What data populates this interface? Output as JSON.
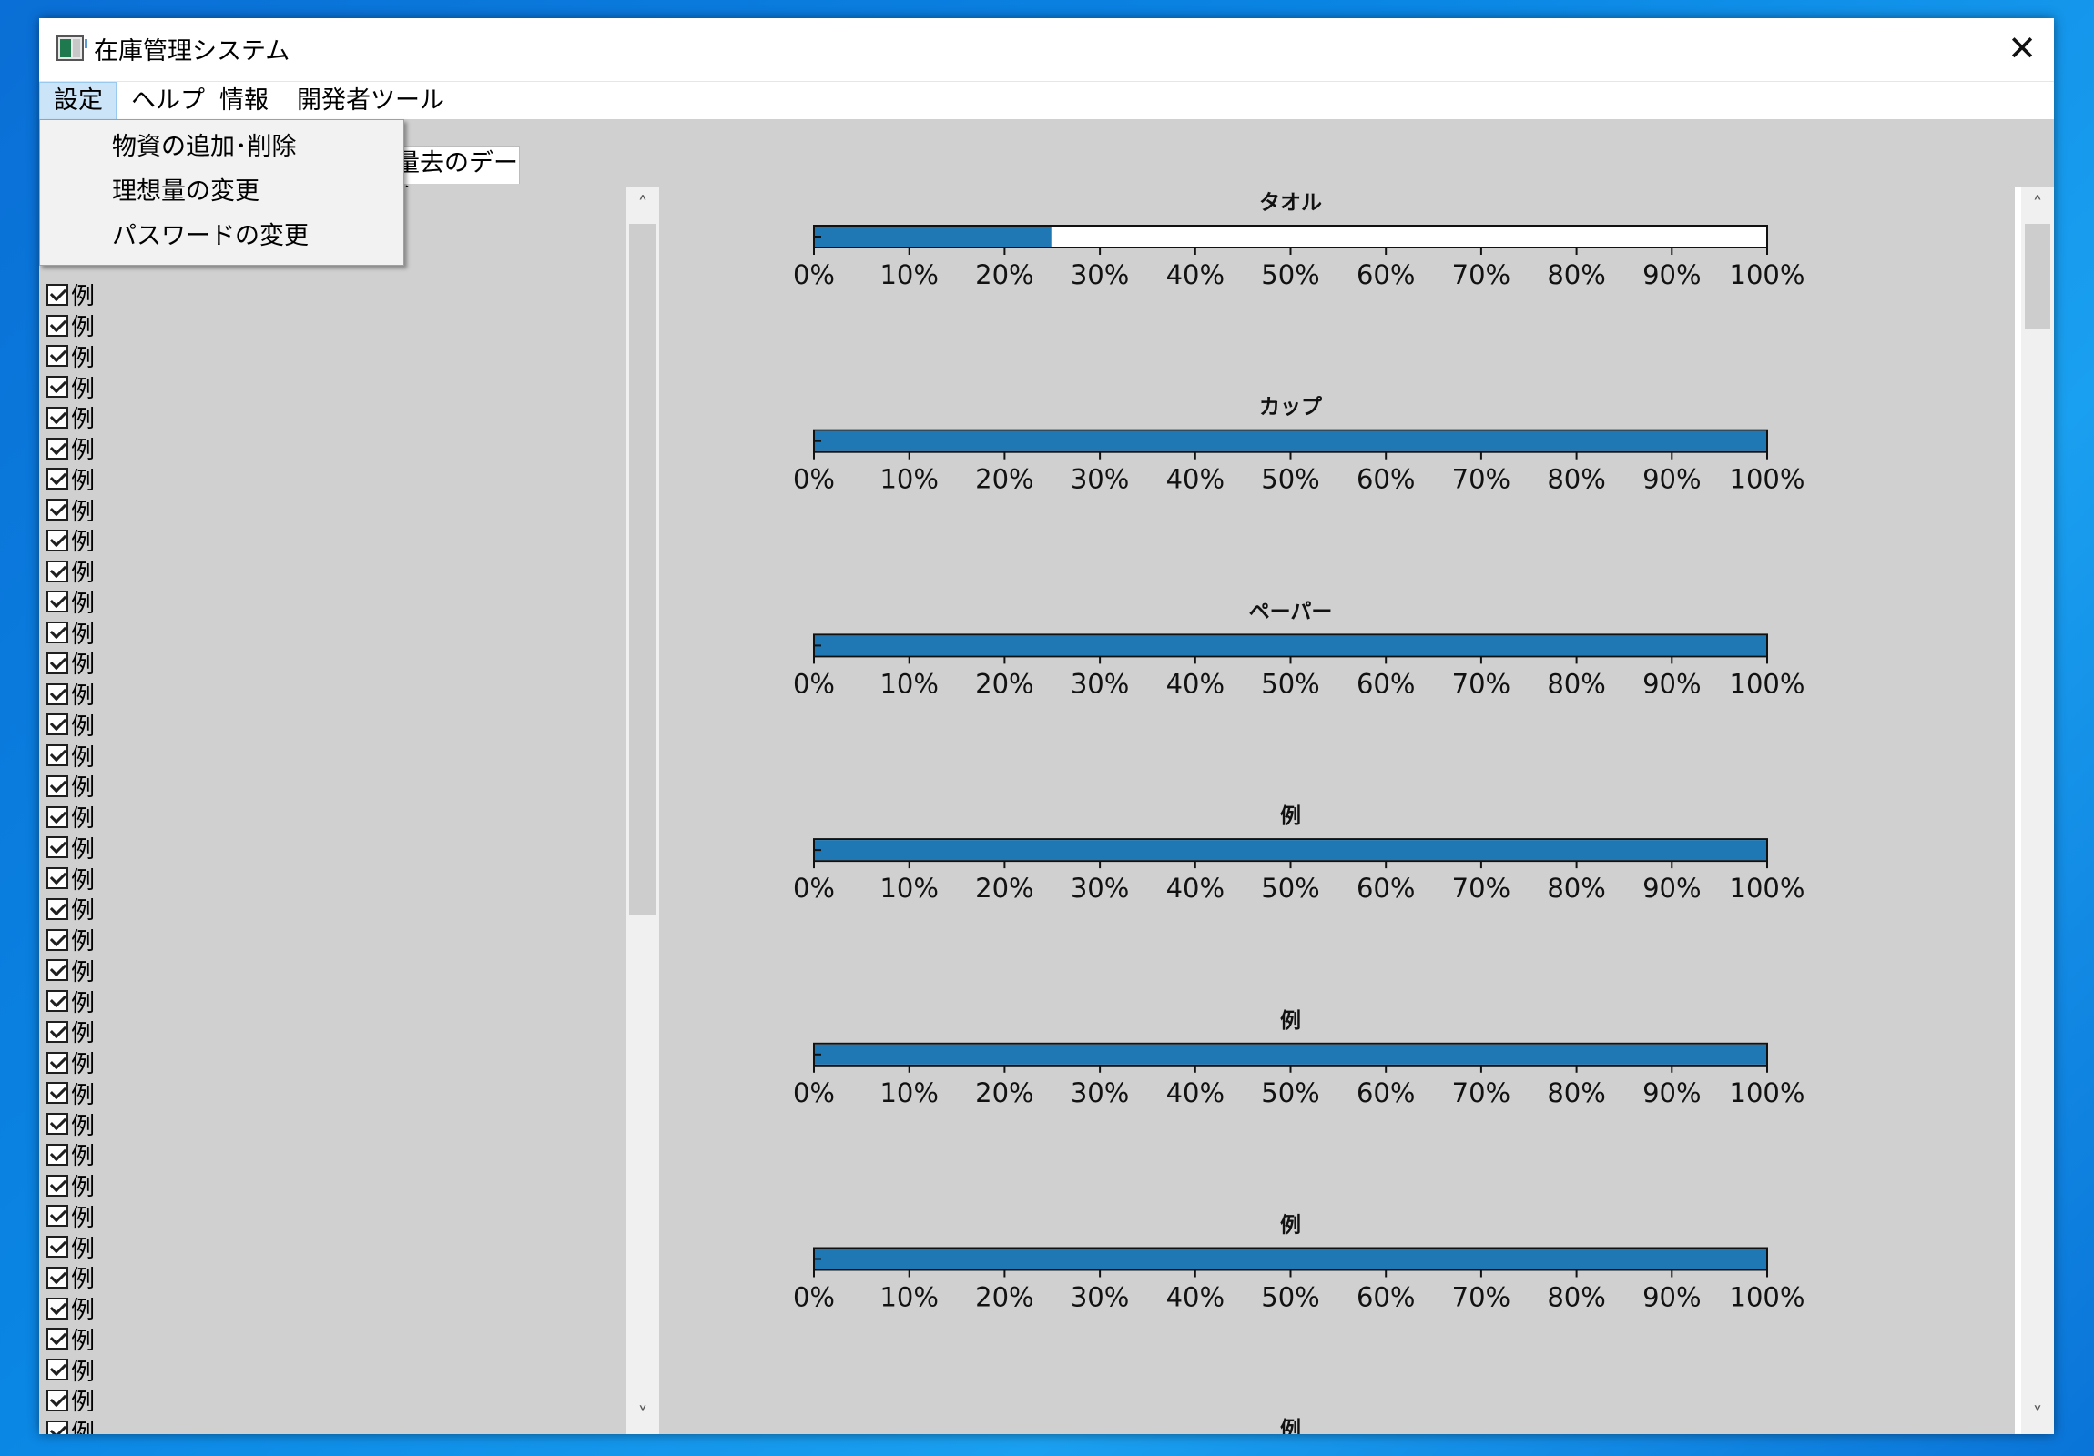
{
  "window": {
    "title": "在庫管理システム",
    "close_glyph": "✕"
  },
  "menubar": {
    "items": [
      {
        "label": "設定",
        "active": true
      },
      {
        "label": "ヘルプ"
      },
      {
        "label": "情報"
      },
      {
        "label": "開発者ツール"
      }
    ]
  },
  "settings_menu": {
    "items": [
      {
        "label": "物資の追加･削除"
      },
      {
        "label": "理想量の変更"
      },
      {
        "label": "パスワードの変更"
      }
    ]
  },
  "tabs": {
    "visible_tab_fragment": "過去のデータ",
    "partially_hidden_text": "量去のデータ"
  },
  "left_list": {
    "rows": [
      "例",
      "例",
      "例",
      "例",
      "例",
      "例",
      "例",
      "例",
      "例",
      "例",
      "例",
      "例",
      "例",
      "例",
      "例",
      "例",
      "例",
      "例",
      "例",
      "例",
      "例",
      "例",
      "例",
      "例",
      "例",
      "例",
      "例",
      "例",
      "例",
      "例",
      "例",
      "例",
      "例",
      "例",
      "例",
      "例",
      "例",
      "例"
    ],
    "checked": true
  },
  "colors": {
    "bar": "#1f77b4",
    "panel_bg": "#d0d0d0",
    "menu_active": "#cce4f7"
  },
  "chart_data": [
    {
      "type": "bar",
      "title": "タオル",
      "value_percent": 25,
      "xlim": [
        0,
        100
      ],
      "ticks": [
        "0%",
        "10%",
        "20%",
        "30%",
        "40%",
        "50%",
        "60%",
        "70%",
        "80%",
        "90%",
        "100%"
      ]
    },
    {
      "type": "bar",
      "title": "カップ",
      "value_percent": 100,
      "xlim": [
        0,
        100
      ],
      "ticks": [
        "0%",
        "10%",
        "20%",
        "30%",
        "40%",
        "50%",
        "60%",
        "70%",
        "80%",
        "90%",
        "100%"
      ]
    },
    {
      "type": "bar",
      "title": "ペーパー",
      "value_percent": 100,
      "xlim": [
        0,
        100
      ],
      "ticks": [
        "0%",
        "10%",
        "20%",
        "30%",
        "40%",
        "50%",
        "60%",
        "70%",
        "80%",
        "90%",
        "100%"
      ]
    },
    {
      "type": "bar",
      "title": "例",
      "value_percent": 100,
      "xlim": [
        0,
        100
      ],
      "ticks": [
        "0%",
        "10%",
        "20%",
        "30%",
        "40%",
        "50%",
        "60%",
        "70%",
        "80%",
        "90%",
        "100%"
      ]
    },
    {
      "type": "bar",
      "title": "例",
      "value_percent": 100,
      "xlim": [
        0,
        100
      ],
      "ticks": [
        "0%",
        "10%",
        "20%",
        "30%",
        "40%",
        "50%",
        "60%",
        "70%",
        "80%",
        "90%",
        "100%"
      ]
    },
    {
      "type": "bar",
      "title": "例",
      "value_percent": 100,
      "xlim": [
        0,
        100
      ],
      "ticks": [
        "0%",
        "10%",
        "20%",
        "30%",
        "40%",
        "50%",
        "60%",
        "70%",
        "80%",
        "90%",
        "100%"
      ]
    },
    {
      "type": "bar",
      "title": "例",
      "value_percent": null,
      "xlim": [
        0,
        100
      ],
      "ticks": []
    }
  ]
}
